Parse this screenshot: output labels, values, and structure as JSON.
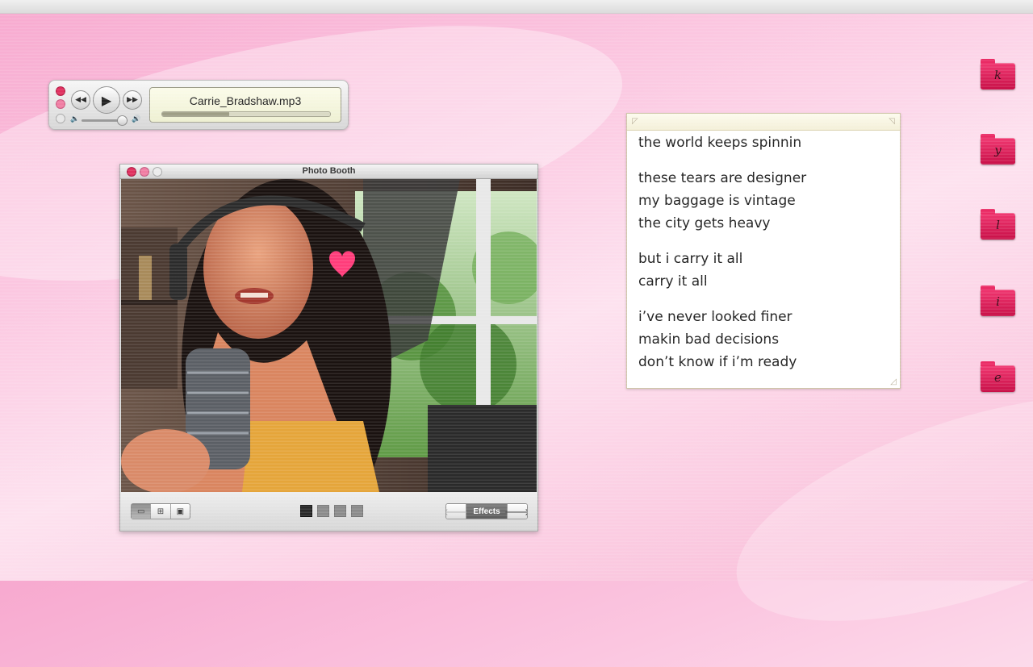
{
  "player": {
    "track_title": "Carrie_Bradshaw.mp3",
    "progress": 0.4,
    "volume": 0.8,
    "icons": [
      "rewind-icon",
      "play-icon",
      "fast-forward-icon",
      "volume-low-icon",
      "volume-high-icon"
    ]
  },
  "photo_booth": {
    "window_title": "Photo Booth",
    "toolbar": {
      "effects_label": "Effects",
      "view_modes": [
        "single-photo-icon",
        "grid-icon",
        "filmstrip-icon"
      ]
    }
  },
  "lyrics": {
    "stanzas": [
      [
        "the world keeps spinnin"
      ],
      [
        "these tears are designer",
        "my baggage is vintage",
        "the city gets heavy"
      ],
      [
        "but i carry it all",
        "carry it all"
      ],
      [
        "i’ve never looked finer",
        "makin bad decisions",
        "don’t know if i’m ready"
      ]
    ]
  },
  "folders": [
    "k",
    "y",
    "l",
    "i",
    "e"
  ],
  "colors": {
    "accent_pink": "#e0305f",
    "folder_pink": "#e52d66",
    "background_pink": "#f9b9d6"
  }
}
